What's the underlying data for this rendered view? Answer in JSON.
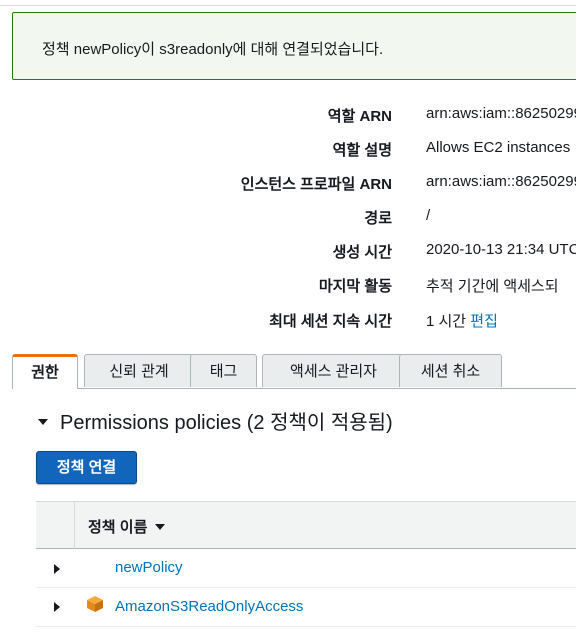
{
  "alert": {
    "message": "정책 newPolicy이 s3readonly에 대해 연결되었습니다."
  },
  "summary": [
    {
      "label": "역할 ARN",
      "value": "arn:aws:iam::86250299"
    },
    {
      "label": "역할 설명",
      "value": "Allows EC2 instances"
    },
    {
      "label": "인스턴스 프로파일 ARN",
      "value": "arn:aws:iam::86250299"
    },
    {
      "label": "경로",
      "value": "/"
    },
    {
      "label": "생성 시간",
      "value": "2020-10-13 21:34 UTC"
    },
    {
      "label": "마지막 활동",
      "value": "추적 기간에 액세스되"
    },
    {
      "label": "최대 세션 지속 시간",
      "value": "1 시간",
      "link": "편집"
    }
  ],
  "tabs": [
    {
      "label": "권한",
      "active": true
    },
    {
      "label": "신뢰 관계",
      "active": false
    },
    {
      "label": "태그",
      "active": false
    },
    {
      "label": "액세스 관리자",
      "active": false
    },
    {
      "label": "세션 취소",
      "active": false
    }
  ],
  "permissions": {
    "title": "Permissions policies (2 정책이 적용됨)",
    "attach_button": "정책 연결",
    "column_header": "정책 이름",
    "policies": [
      {
        "name": "newPolicy",
        "icon": "none"
      },
      {
        "name": "AmazonS3ReadOnlyAccess",
        "icon": "aws-managed-cube-icon"
      }
    ]
  },
  "colors": {
    "accent": "#ec7211",
    "link": "#0073bb",
    "primary_button": "#1166bb",
    "success_border": "#1d8102"
  }
}
